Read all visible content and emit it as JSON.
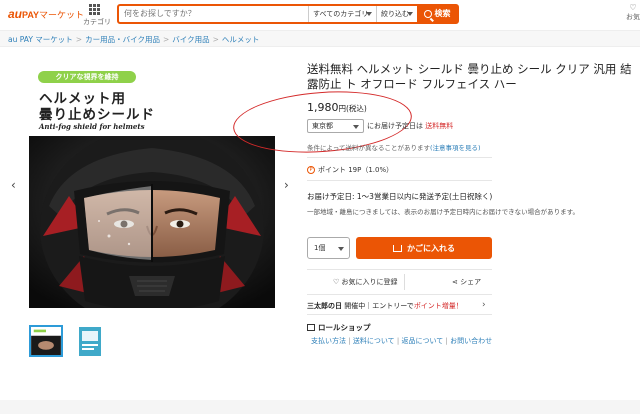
{
  "header": {
    "logo_au": "au",
    "logo_pay": "PAY",
    "logo_market": "マーケット",
    "category_label": "カテゴリ",
    "search_placeholder": "何をお探しですか？",
    "category_select": "すべてのカテゴリ",
    "refine_select": "絞り込む",
    "search_button": "検索",
    "favorite_label": "お気"
  },
  "breadcrumb": [
    "au PAY マーケット",
    "カー用品・バイク用品",
    "バイク用品",
    "ヘルメット"
  ],
  "product_image": {
    "badge": "クリアな視界を維持",
    "heading_line1": "ヘルメット用",
    "heading_line2": "曇り止めシールド",
    "heading_en": "Anti-fog shield for helmets"
  },
  "product": {
    "title": "送料無料 ヘルメット シールド 曇り止め シール クリア 汎用 結露防止 ト オフロード フルフェイス ハー",
    "price": "1,980",
    "price_suffix": "円(税込)",
    "prefecture": "東京都",
    "shipping_text": "にお届け予定日は",
    "shipping_free": "送料無料",
    "condition_text": "条件によって送料が異なることがあります",
    "condition_link": "(注意事項を見る)",
    "point_text": "ポイント 19P（1.0%）",
    "delivery": "お届け予定日: 1〜3営業日以内に発送予定(土日祝除く)",
    "delivery_note": "一部地域・離島につきましては、表示のお届け予定日時内にお届けできない場合があります。",
    "quantity": "1個",
    "cart_button": "かごに入れる",
    "favorite_button": "お気に入りに登録",
    "share_button": "シェア",
    "promo_bold": "三太郎の日",
    "promo_mid": " 開催中｜エントリーで",
    "promo_red": "ポイント増量！",
    "shop_name": "ロールショップ",
    "shop_links": [
      "支払い方法",
      "送料について",
      "返品について",
      "お問い合わせ"
    ]
  },
  "colors": {
    "accent": "#eb5505",
    "link": "#2d7fb8",
    "annotation": "#d42a2a"
  }
}
